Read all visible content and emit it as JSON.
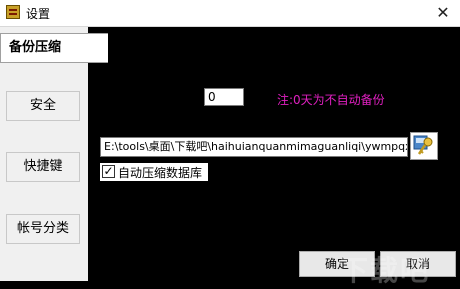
{
  "window": {
    "title": "设置",
    "close_glyph": "✕"
  },
  "sidebar": {
    "tabs": [
      {
        "label": "备份压缩",
        "active": true
      },
      {
        "label": "安全"
      },
      {
        "label": "快捷键"
      },
      {
        "label": "帐号分类"
      }
    ]
  },
  "backup": {
    "days_value": "0",
    "note": "注:0天为不自动备份",
    "path_value": "E:\\tools\\桌面\\下载吧\\haihuianquanmimaguanliqi\\ywmpqxzzfm",
    "auto_compress_label": "自动压缩数据库",
    "auto_compress_checked": true,
    "check_glyph": "✓"
  },
  "buttons": {
    "ok_label": "确定",
    "cancel_label": "取消"
  },
  "watermark": "下载吧",
  "colors": {
    "panel_background": "#000000",
    "note_color": "#e020c0"
  }
}
